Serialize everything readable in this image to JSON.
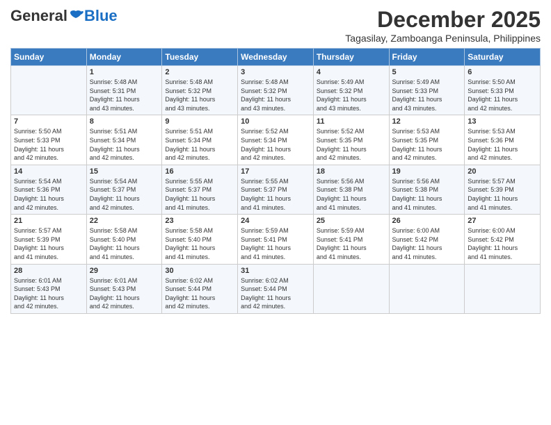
{
  "header": {
    "logo_general": "General",
    "logo_blue": "Blue",
    "title": "December 2025",
    "location": "Tagasilay, Zamboanga Peninsula, Philippines"
  },
  "days_of_week": [
    "Sunday",
    "Monday",
    "Tuesday",
    "Wednesday",
    "Thursday",
    "Friday",
    "Saturday"
  ],
  "weeks": [
    [
      {
        "day": "",
        "info": ""
      },
      {
        "day": "1",
        "info": "Sunrise: 5:48 AM\nSunset: 5:31 PM\nDaylight: 11 hours\nand 43 minutes."
      },
      {
        "day": "2",
        "info": "Sunrise: 5:48 AM\nSunset: 5:32 PM\nDaylight: 11 hours\nand 43 minutes."
      },
      {
        "day": "3",
        "info": "Sunrise: 5:48 AM\nSunset: 5:32 PM\nDaylight: 11 hours\nand 43 minutes."
      },
      {
        "day": "4",
        "info": "Sunrise: 5:49 AM\nSunset: 5:32 PM\nDaylight: 11 hours\nand 43 minutes."
      },
      {
        "day": "5",
        "info": "Sunrise: 5:49 AM\nSunset: 5:33 PM\nDaylight: 11 hours\nand 43 minutes."
      },
      {
        "day": "6",
        "info": "Sunrise: 5:50 AM\nSunset: 5:33 PM\nDaylight: 11 hours\nand 42 minutes."
      }
    ],
    [
      {
        "day": "7",
        "info": "Sunrise: 5:50 AM\nSunset: 5:33 PM\nDaylight: 11 hours\nand 42 minutes."
      },
      {
        "day": "8",
        "info": "Sunrise: 5:51 AM\nSunset: 5:34 PM\nDaylight: 11 hours\nand 42 minutes."
      },
      {
        "day": "9",
        "info": "Sunrise: 5:51 AM\nSunset: 5:34 PM\nDaylight: 11 hours\nand 42 minutes."
      },
      {
        "day": "10",
        "info": "Sunrise: 5:52 AM\nSunset: 5:34 PM\nDaylight: 11 hours\nand 42 minutes."
      },
      {
        "day": "11",
        "info": "Sunrise: 5:52 AM\nSunset: 5:35 PM\nDaylight: 11 hours\nand 42 minutes."
      },
      {
        "day": "12",
        "info": "Sunrise: 5:53 AM\nSunset: 5:35 PM\nDaylight: 11 hours\nand 42 minutes."
      },
      {
        "day": "13",
        "info": "Sunrise: 5:53 AM\nSunset: 5:36 PM\nDaylight: 11 hours\nand 42 minutes."
      }
    ],
    [
      {
        "day": "14",
        "info": "Sunrise: 5:54 AM\nSunset: 5:36 PM\nDaylight: 11 hours\nand 42 minutes."
      },
      {
        "day": "15",
        "info": "Sunrise: 5:54 AM\nSunset: 5:37 PM\nDaylight: 11 hours\nand 42 minutes."
      },
      {
        "day": "16",
        "info": "Sunrise: 5:55 AM\nSunset: 5:37 PM\nDaylight: 11 hours\nand 41 minutes."
      },
      {
        "day": "17",
        "info": "Sunrise: 5:55 AM\nSunset: 5:37 PM\nDaylight: 11 hours\nand 41 minutes."
      },
      {
        "day": "18",
        "info": "Sunrise: 5:56 AM\nSunset: 5:38 PM\nDaylight: 11 hours\nand 41 minutes."
      },
      {
        "day": "19",
        "info": "Sunrise: 5:56 AM\nSunset: 5:38 PM\nDaylight: 11 hours\nand 41 minutes."
      },
      {
        "day": "20",
        "info": "Sunrise: 5:57 AM\nSunset: 5:39 PM\nDaylight: 11 hours\nand 41 minutes."
      }
    ],
    [
      {
        "day": "21",
        "info": "Sunrise: 5:57 AM\nSunset: 5:39 PM\nDaylight: 11 hours\nand 41 minutes."
      },
      {
        "day": "22",
        "info": "Sunrise: 5:58 AM\nSunset: 5:40 PM\nDaylight: 11 hours\nand 41 minutes."
      },
      {
        "day": "23",
        "info": "Sunrise: 5:58 AM\nSunset: 5:40 PM\nDaylight: 11 hours\nand 41 minutes."
      },
      {
        "day": "24",
        "info": "Sunrise: 5:59 AM\nSunset: 5:41 PM\nDaylight: 11 hours\nand 41 minutes."
      },
      {
        "day": "25",
        "info": "Sunrise: 5:59 AM\nSunset: 5:41 PM\nDaylight: 11 hours\nand 41 minutes."
      },
      {
        "day": "26",
        "info": "Sunrise: 6:00 AM\nSunset: 5:42 PM\nDaylight: 11 hours\nand 41 minutes."
      },
      {
        "day": "27",
        "info": "Sunrise: 6:00 AM\nSunset: 5:42 PM\nDaylight: 11 hours\nand 41 minutes."
      }
    ],
    [
      {
        "day": "28",
        "info": "Sunrise: 6:01 AM\nSunset: 5:43 PM\nDaylight: 11 hours\nand 42 minutes."
      },
      {
        "day": "29",
        "info": "Sunrise: 6:01 AM\nSunset: 5:43 PM\nDaylight: 11 hours\nand 42 minutes."
      },
      {
        "day": "30",
        "info": "Sunrise: 6:02 AM\nSunset: 5:44 PM\nDaylight: 11 hours\nand 42 minutes."
      },
      {
        "day": "31",
        "info": "Sunrise: 6:02 AM\nSunset: 5:44 PM\nDaylight: 11 hours\nand 42 minutes."
      },
      {
        "day": "",
        "info": ""
      },
      {
        "day": "",
        "info": ""
      },
      {
        "day": "",
        "info": ""
      }
    ]
  ]
}
